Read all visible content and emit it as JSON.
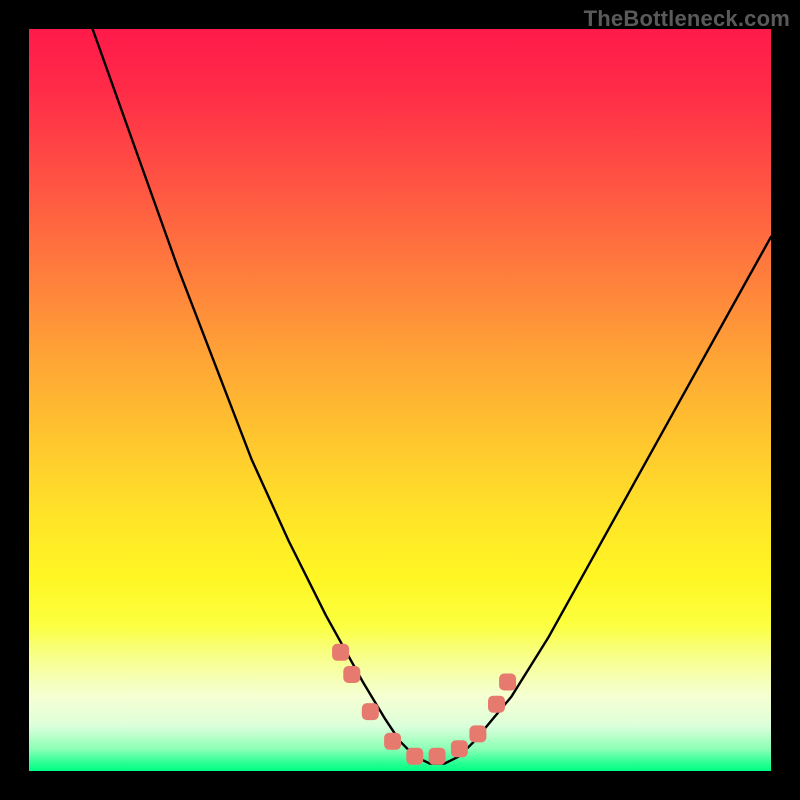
{
  "watermark": "TheBottleneck.com",
  "chart_data": {
    "type": "line",
    "title": "",
    "xlabel": "",
    "ylabel": "",
    "xlim": [
      0,
      100
    ],
    "ylim": [
      0,
      100
    ],
    "grid": false,
    "legend": false,
    "x": [
      0,
      5,
      10,
      15,
      20,
      25,
      30,
      35,
      40,
      45,
      48,
      50,
      52,
      54,
      56,
      58,
      60,
      65,
      70,
      75,
      80,
      85,
      90,
      95,
      100
    ],
    "series": [
      {
        "name": "curve",
        "values": [
          125,
          110,
          96,
          82,
          68,
          55,
          42,
          31,
          21,
          12,
          7,
          4,
          2,
          1,
          1,
          2,
          4,
          10,
          18,
          27,
          36,
          45,
          54,
          63,
          72
        ]
      }
    ],
    "markers": {
      "shape": "rounded-square",
      "color": "#e77a6f",
      "points": [
        {
          "x": 42,
          "y": 16
        },
        {
          "x": 43.5,
          "y": 13
        },
        {
          "x": 46,
          "y": 8
        },
        {
          "x": 49,
          "y": 4
        },
        {
          "x": 52,
          "y": 2
        },
        {
          "x": 55,
          "y": 2
        },
        {
          "x": 58,
          "y": 3
        },
        {
          "x": 60.5,
          "y": 5
        },
        {
          "x": 63,
          "y": 9
        },
        {
          "x": 64.5,
          "y": 12
        }
      ]
    },
    "background": {
      "type": "vertical-gradient",
      "stops": [
        {
          "pos": 0.0,
          "color": "#ff1a4a"
        },
        {
          "pos": 0.5,
          "color": "#ffc22e"
        },
        {
          "pos": 0.78,
          "color": "#fcff3e"
        },
        {
          "pos": 0.92,
          "color": "#edffb0"
        },
        {
          "pos": 1.0,
          "color": "#00ff84"
        }
      ]
    }
  }
}
